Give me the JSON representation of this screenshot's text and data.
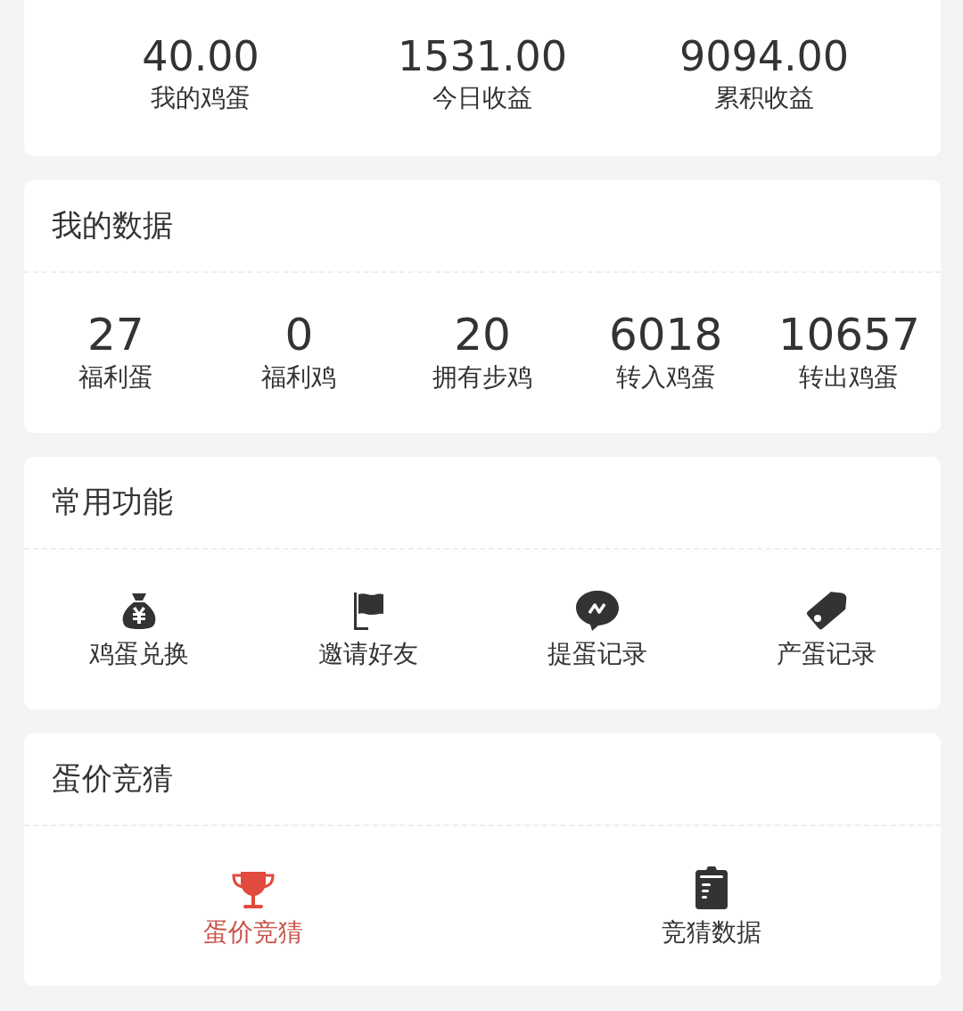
{
  "summary": [
    {
      "value": "40.00",
      "label": "我的鸡蛋"
    },
    {
      "value": "1531.00",
      "label": "今日收益"
    },
    {
      "value": "9094.00",
      "label": "累积收益"
    }
  ],
  "my_data": {
    "title": "我的数据",
    "stats": [
      {
        "value": "27",
        "label": "福利蛋"
      },
      {
        "value": "0",
        "label": "福利鸡"
      },
      {
        "value": "20",
        "label": "拥有步鸡"
      },
      {
        "value": "6018",
        "label": "转入鸡蛋"
      },
      {
        "value": "10657",
        "label": "转出鸡蛋"
      }
    ]
  },
  "functions": {
    "title": "常用功能",
    "items": [
      {
        "kind": "moneybag",
        "label": "鸡蛋兑换"
      },
      {
        "kind": "flag",
        "label": "邀请好友"
      },
      {
        "kind": "chat",
        "label": "提蛋记录"
      },
      {
        "kind": "tag",
        "label": "产蛋记录"
      }
    ]
  },
  "guess": {
    "title": "蛋价竞猜",
    "items": [
      {
        "kind": "trophy",
        "label": "蛋价竞猜",
        "selected": true
      },
      {
        "kind": "clipboard",
        "label": "竞猜数据",
        "selected": false
      }
    ]
  }
}
